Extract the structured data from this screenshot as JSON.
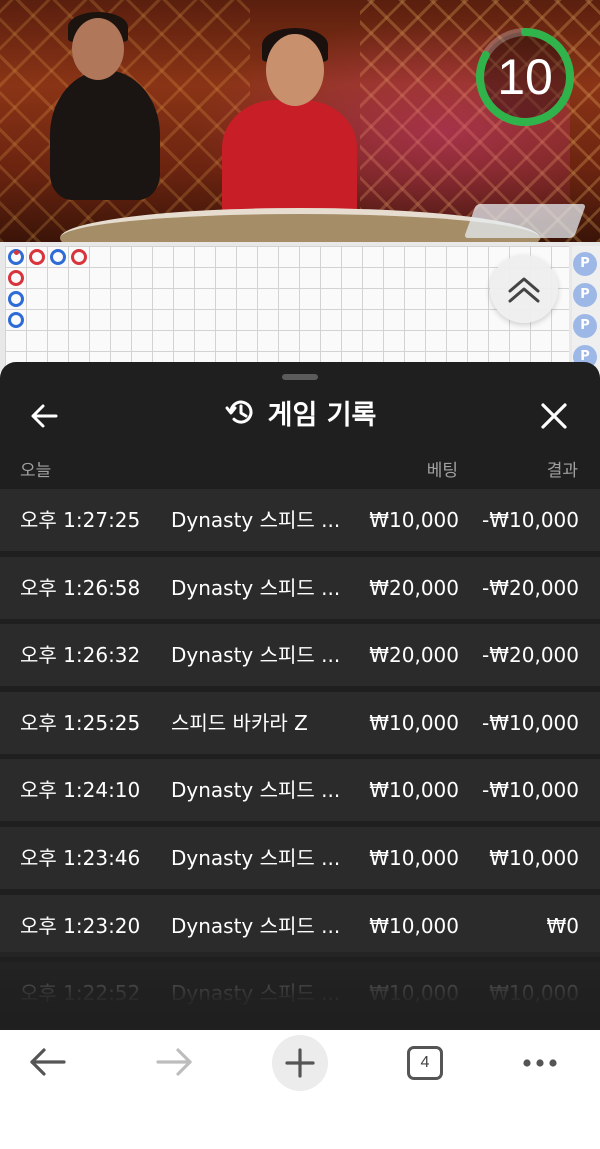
{
  "stream": {
    "countdown": "10",
    "countdown_fraction": 0.83,
    "timer_color": "#2fb34a"
  },
  "roadmap": {
    "beads": [
      {
        "col": 0,
        "row": 0,
        "color": "blue",
        "marker": true
      },
      {
        "col": 1,
        "row": 0,
        "color": "red"
      },
      {
        "col": 2,
        "row": 0,
        "color": "blue"
      },
      {
        "col": 3,
        "row": 0,
        "color": "red"
      },
      {
        "col": 0,
        "row": 1,
        "color": "red"
      },
      {
        "col": 0,
        "row": 2,
        "color": "blue"
      },
      {
        "col": 0,
        "row": 3,
        "color": "blue"
      }
    ],
    "side_labels": [
      "P",
      "P",
      "P",
      "P"
    ]
  },
  "history": {
    "title": "게임 기록",
    "columns": {
      "date": "오늘",
      "bet": "베팅",
      "result": "결과"
    },
    "rows": [
      {
        "time": "오후 1:27:25",
        "game": "Dynasty 스피드 ...",
        "bet": "₩10,000",
        "result": "-₩10,000"
      },
      {
        "time": "오후 1:26:58",
        "game": "Dynasty 스피드 ...",
        "bet": "₩20,000",
        "result": "-₩20,000"
      },
      {
        "time": "오후 1:26:32",
        "game": "Dynasty 스피드 ...",
        "bet": "₩20,000",
        "result": "-₩20,000"
      },
      {
        "time": "오후 1:25:25",
        "game": "스피드 바카라 Z",
        "bet": "₩10,000",
        "result": "-₩10,000"
      },
      {
        "time": "오후 1:24:10",
        "game": "Dynasty 스피드 ...",
        "bet": "₩10,000",
        "result": "-₩10,000"
      },
      {
        "time": "오후 1:23:46",
        "game": "Dynasty 스피드 ...",
        "bet": "₩10,000",
        "result": "₩10,000"
      },
      {
        "time": "오후 1:23:20",
        "game": "Dynasty 스피드 ...",
        "bet": "₩10,000",
        "result": "₩0"
      },
      {
        "time": "오후 1:22:52",
        "game": "Dynasty 스피드 ...",
        "bet": "₩10,000",
        "result": "₩10,000"
      }
    ]
  },
  "browser": {
    "tab_count": "4",
    "icons": [
      "back-arrow-icon",
      "forward-arrow-icon",
      "plus-icon",
      "tabs-icon",
      "more-dots-icon"
    ]
  }
}
